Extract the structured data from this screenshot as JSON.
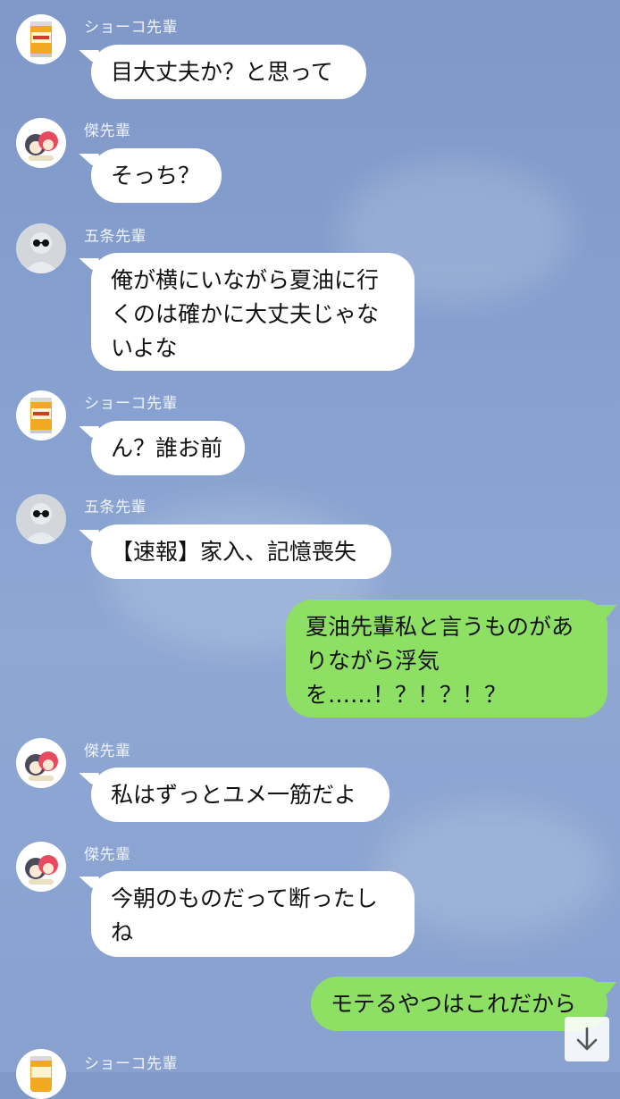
{
  "senders": {
    "shoko": "ショーコ先輩",
    "geto": "傑先輩",
    "gojo": "五条先輩"
  },
  "messages": [
    {
      "text": "目大丈夫か？と思って"
    },
    {
      "text": "そっち？"
    },
    {
      "lines": [
        "俺が横にいながら夏油に行",
        "くのは確かに大丈夫じゃな",
        "いよな"
      ]
    },
    {
      "text": "ん？誰お前"
    },
    {
      "text": "【速報】家入、記憶喪失"
    },
    {
      "lines": [
        "夏油先輩私と言うものがあ",
        "りながら浮気",
        "を……！？！？！？"
      ]
    },
    {
      "text": "私はずっとユメ一筋だよ"
    },
    {
      "lines": [
        "今朝のものだって断ったし",
        "ね"
      ]
    },
    {
      "text": "モテるやつはこれだから"
    }
  ],
  "icons": {
    "can_avatar": "beer-can-avatar-icon",
    "geto_avatar": "chibi-characters-avatar-icon",
    "gojo_avatar": "sunglasses-avatar-icon",
    "scroll": "arrow-down-icon"
  },
  "colors": {
    "background": "#86a0cf",
    "incoming_bubble": "#ffffff",
    "outgoing_bubble": "#8ee065"
  }
}
